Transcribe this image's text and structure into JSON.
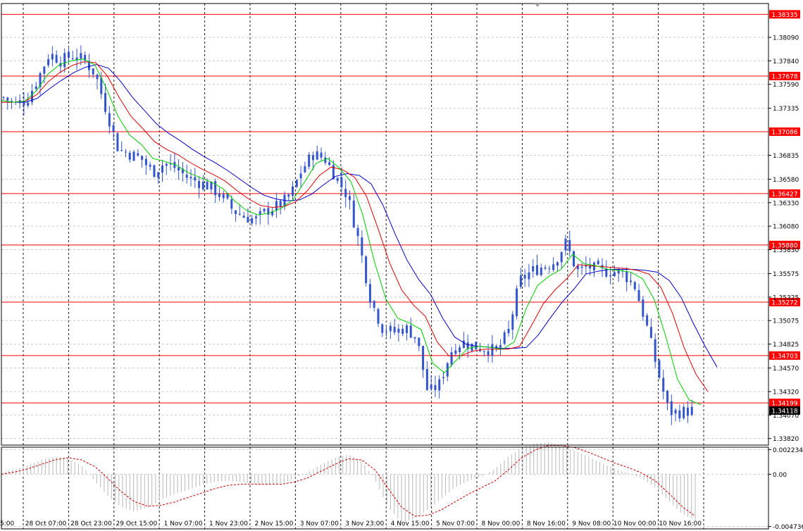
{
  "colors": {
    "background": "#ffffff",
    "frame": "#000000",
    "grid": "#000000",
    "candle": "#3355cc",
    "levels": "#ff0000",
    "ma_fast": "#00cc00",
    "ma_mid": "#dd0000",
    "ma_slow": "#0000cc",
    "histogram": "#b8b8b8",
    "signal": "#cc0000",
    "price_tag": "#000000"
  },
  "chart_data": [
    {
      "type": "candlestick",
      "title": "",
      "ylim": [
        1.3375,
        1.3845
      ],
      "x_labels": [
        "5:00",
        "28 Oct 07:00",
        "28 Oct 23:00",
        "29 Oct 15:00",
        "1 Nov 07:00",
        "1 Nov 23:00",
        "2 Nov 15:00",
        "3 Nov 07:00",
        "3 Nov 23:00",
        "4 Nov 15:00",
        "5 Nov 07:00",
        "8 Nov 00:00",
        "8 Nov 16:00",
        "9 Nov 08:00",
        "10 Nov 00:00",
        "10 Nov 16:00"
      ],
      "y_ticks": [
        "1.38090",
        "1.37840",
        "1.37590",
        "1.37335",
        "1.36835",
        "1.36580",
        "1.36330",
        "1.36080",
        "1.35830",
        "1.35575",
        "1.35325",
        "1.35075",
        "1.34825",
        "1.34570",
        "1.34320",
        "1.34070",
        "1.33820"
      ],
      "y_tick_values": [
        1.3809,
        1.3784,
        1.3759,
        1.37335,
        1.36835,
        1.3658,
        1.3633,
        1.3608,
        1.3583,
        1.35575,
        1.35325,
        1.35075,
        1.34825,
        1.3457,
        1.3432,
        1.3407,
        1.3382
      ],
      "levels": [
        {
          "value": 1.38335,
          "label": "1.38335"
        },
        {
          "value": 1.37678,
          "label": "1.37678"
        },
        {
          "value": 1.37086,
          "label": "1.37086"
        },
        {
          "value": 1.36427,
          "label": "1.36427"
        },
        {
          "value": 1.3588,
          "label": "1.35880"
        },
        {
          "value": 1.35272,
          "label": "1.35272"
        },
        {
          "value": 1.34703,
          "label": "1.34703"
        },
        {
          "value": 1.34199,
          "label": "1.34199"
        }
      ],
      "current_price": {
        "value": 1.34118,
        "label": "1.34118"
      },
      "close_path": [
        1.3745,
        1.3738,
        1.3742,
        1.3765,
        1.3792,
        1.3784,
        1.379,
        1.3785,
        1.377,
        1.373,
        1.369,
        1.3685,
        1.368,
        1.3665,
        1.3675,
        1.367,
        1.366,
        1.3655,
        1.365,
        1.364,
        1.3625,
        1.3618,
        1.3615,
        1.3625,
        1.363,
        1.364,
        1.3668,
        1.3685,
        1.368,
        1.366,
        1.364,
        1.359,
        1.353,
        1.35,
        1.3495,
        1.35,
        1.349,
        1.343,
        1.344,
        1.3475,
        1.3485,
        1.348,
        1.3478,
        1.3475,
        1.3495,
        1.355,
        1.356,
        1.3565,
        1.357,
        1.359,
        1.356,
        1.3565,
        1.356,
        1.356,
        1.3558,
        1.3545,
        1.3505,
        1.3455,
        1.341,
        1.341,
        1.3412
      ],
      "ma_fast": [
        1.3742,
        1.374,
        1.3741,
        1.3752,
        1.377,
        1.378,
        1.3784,
        1.3786,
        1.378,
        1.3755,
        1.3725,
        1.3705,
        1.3695,
        1.368,
        1.3677,
        1.3673,
        1.3665,
        1.366,
        1.3655,
        1.3648,
        1.3635,
        1.3625,
        1.362,
        1.3622,
        1.3627,
        1.3636,
        1.3655,
        1.3675,
        1.368,
        1.367,
        1.3655,
        1.362,
        1.357,
        1.353,
        1.351,
        1.3505,
        1.3498,
        1.3462,
        1.3452,
        1.3465,
        1.3478,
        1.348,
        1.3479,
        1.3477,
        1.3485,
        1.352,
        1.3545,
        1.3555,
        1.3562,
        1.3578,
        1.3568,
        1.3566,
        1.3562,
        1.3561,
        1.3559,
        1.3552,
        1.353,
        1.349,
        1.3445,
        1.3423,
        1.3418
      ],
      "ma_mid": [
        1.374,
        1.374,
        1.3741,
        1.3748,
        1.3762,
        1.3772,
        1.3779,
        1.3783,
        1.3782,
        1.3768,
        1.3745,
        1.3725,
        1.3712,
        1.3698,
        1.369,
        1.3684,
        1.3676,
        1.3669,
        1.3663,
        1.3656,
        1.3646,
        1.3637,
        1.363,
        1.3628,
        1.3629,
        1.3634,
        1.3646,
        1.3662,
        1.3671,
        1.3668,
        1.366,
        1.364,
        1.3605,
        1.3568,
        1.354,
        1.3524,
        1.3512,
        1.3485,
        1.347,
        1.347,
        1.3475,
        1.3477,
        1.3477,
        1.3477,
        1.348,
        1.3502,
        1.3525,
        1.354,
        1.3552,
        1.3567,
        1.3566,
        1.3565,
        1.3564,
        1.3563,
        1.3561,
        1.3557,
        1.3543,
        1.3515,
        1.3478,
        1.345,
        1.3432
      ],
      "ma_slow": [
        1.374,
        1.374,
        1.374,
        1.3744,
        1.3754,
        1.3763,
        1.3771,
        1.3777,
        1.378,
        1.3776,
        1.3762,
        1.3745,
        1.3731,
        1.3717,
        1.3707,
        1.3699,
        1.369,
        1.3682,
        1.3675,
        1.3667,
        1.3658,
        1.3649,
        1.3641,
        1.3637,
        1.3635,
        1.3636,
        1.3642,
        1.3652,
        1.3661,
        1.3664,
        1.3662,
        1.3653,
        1.363,
        1.36,
        1.3572,
        1.3551,
        1.3535,
        1.351,
        1.349,
        1.3482,
        1.348,
        1.3479,
        1.3478,
        1.3478,
        1.3479,
        1.3492,
        1.351,
        1.3527,
        1.3541,
        1.3557,
        1.356,
        1.3562,
        1.3562,
        1.3562,
        1.3561,
        1.3559,
        1.355,
        1.3532,
        1.3505,
        1.348,
        1.3458
      ]
    },
    {
      "type": "histogram",
      "ylim": [
        -0.00495,
        0.00245
      ],
      "y_ticks": [
        "0.002234",
        "0.00",
        "-0.004736"
      ],
      "y_tick_values": [
        0.002234,
        0.0,
        -0.004736
      ],
      "histogram": [
        0.0002,
        0.0004,
        0.0008,
        0.0013,
        0.0016,
        0.0014,
        0.0008,
        -0.0006,
        -0.002,
        -0.003,
        -0.0034,
        -0.003,
        -0.0023,
        -0.0018,
        -0.0014,
        -0.001,
        -0.0007,
        -0.0006,
        -0.0007,
        -0.0009,
        -0.001,
        -0.0008,
        -0.0004,
        0.0002,
        0.0009,
        0.0015,
        0.0018,
        0.0012,
        -0.0005,
        -0.003,
        -0.0044,
        -0.004,
        -0.0032,
        -0.0022,
        -0.0012,
        -0.0006,
        -0.0002,
        0.0005,
        0.0016,
        0.0024,
        0.0028,
        0.0029,
        0.0026,
        0.0021,
        0.0016,
        0.001,
        0.0005,
        0.0001,
        -0.0004,
        -0.0012,
        -0.0024,
        -0.0036,
        -0.0042
      ],
      "signal": [
        0.0,
        0.0002,
        0.0005,
        0.0009,
        0.0013,
        0.0015,
        0.0013,
        0.0007,
        -0.0004,
        -0.0016,
        -0.0025,
        -0.0029,
        -0.0028,
        -0.0025,
        -0.0021,
        -0.0017,
        -0.0013,
        -0.001,
        -0.0009,
        -0.0009,
        -0.0009,
        -0.0009,
        -0.0007,
        -0.0003,
        0.0003,
        0.0009,
        0.0014,
        0.0013,
        0.0004,
        -0.0013,
        -0.003,
        -0.0038,
        -0.0037,
        -0.0032,
        -0.0025,
        -0.0018,
        -0.0012,
        -0.0006,
        0.0004,
        0.0015,
        0.0022,
        0.0026,
        0.0026,
        0.0024,
        0.002,
        0.0015,
        0.001,
        0.0006,
        0.0001,
        -0.0006,
        -0.0017,
        -0.0029,
        -0.0038
      ]
    }
  ]
}
